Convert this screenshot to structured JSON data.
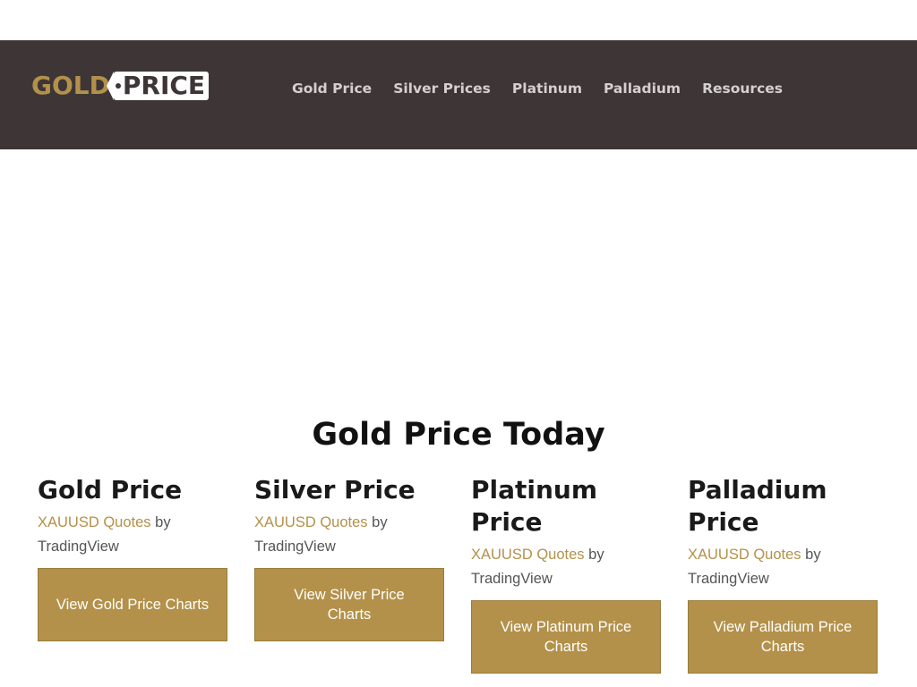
{
  "header": {
    "logo": {
      "left": "GOLD",
      "right": "PRICE"
    },
    "nav": [
      "Gold Price",
      "Silver Prices",
      "Platinum",
      "Palladium",
      "Resources"
    ]
  },
  "main": {
    "heading": "Gold Price Today",
    "cards": [
      {
        "title": "Gold Price",
        "quote_link": "XAUUSD Quotes",
        "quote_by": "by",
        "quote_source": "TradingView",
        "button": "View Gold Price Charts"
      },
      {
        "title": "Silver Price",
        "quote_link": "XAUUSD Quotes",
        "quote_by": "by",
        "quote_source": "TradingView",
        "button": "View Silver Price Charts"
      },
      {
        "title": "Platinum Price",
        "quote_link": "XAUUSD Quotes",
        "quote_by": "by",
        "quote_source": "TradingView",
        "button": "View Platinum Price Charts"
      },
      {
        "title": "Palladium Price",
        "quote_link": "XAUUSD Quotes",
        "quote_by": "by",
        "quote_source": "TradingView",
        "button": "View Palladium Price Charts"
      }
    ]
  },
  "colors": {
    "header_bg": "#3e3636",
    "accent_gold": "#b3914a",
    "nav_text": "#d4d0cc"
  }
}
